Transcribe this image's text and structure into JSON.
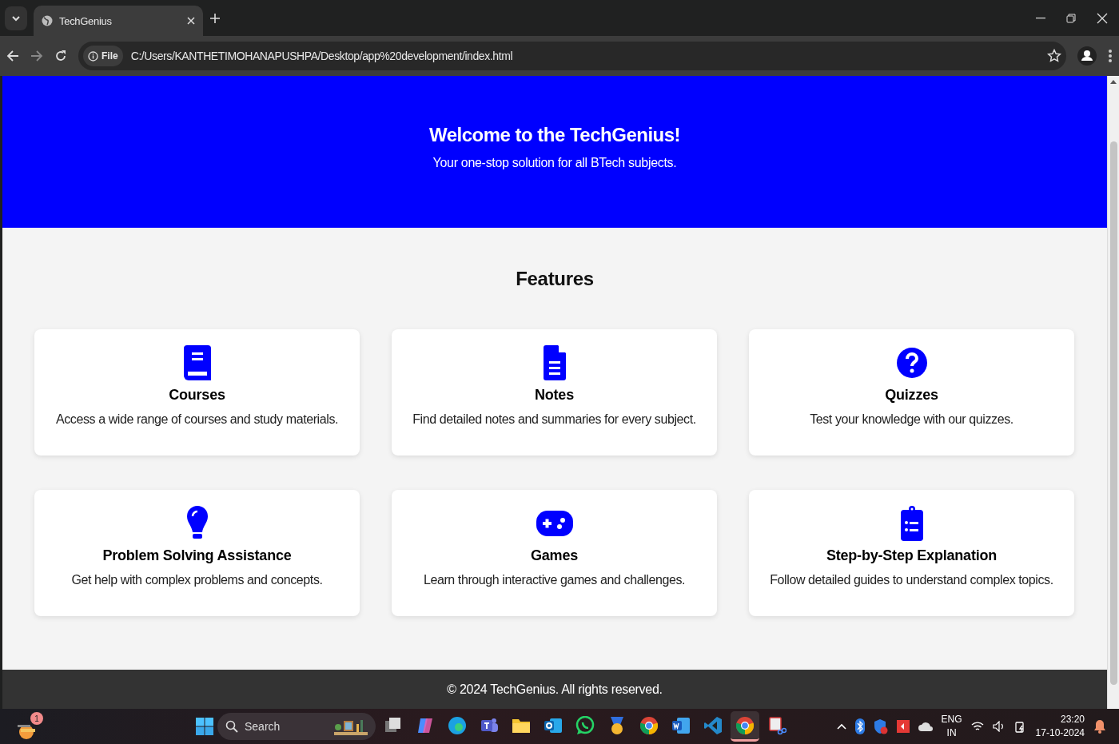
{
  "browser": {
    "tab": {
      "title": "TechGenius",
      "selected": true
    },
    "address": {
      "badge": "File",
      "url": "C:/Users/KANTHETIMOHANAPUSHPA/Desktop/app%20development/index.html"
    }
  },
  "hero": {
    "title": "Welcome to the TechGenius!",
    "subtitle": "Your one-stop solution for all BTech subjects."
  },
  "features": {
    "heading": "Features",
    "cards": [
      {
        "kind": "book",
        "title": "Courses",
        "text": "Access a wide range of courses and study materials."
      },
      {
        "kind": "file",
        "title": "Notes",
        "text": "Find detailed notes and summaries for every subject."
      },
      {
        "kind": "question",
        "title": "Quizzes",
        "text": "Test your knowledge with our quizzes."
      },
      {
        "kind": "bulb",
        "title": "Problem Solving Assistance",
        "text": "Get help with complex problems and concepts."
      },
      {
        "kind": "gamepad",
        "title": "Games",
        "text": "Learn through interactive games and challenges."
      },
      {
        "kind": "clipboard",
        "title": "Step-by-Step Explanation",
        "text": "Follow detailed guides to understand complex topics."
      }
    ]
  },
  "footer": {
    "text": "© 2024 TechGenius. All rights reserved."
  },
  "taskbar": {
    "widget_badge": "1",
    "search": {
      "placeholder": "Search"
    },
    "apps": [
      {
        "kind": "taskview",
        "selected": false
      },
      {
        "kind": "copilot",
        "selected": false
      },
      {
        "kind": "edge",
        "selected": false
      },
      {
        "kind": "teams",
        "selected": false
      },
      {
        "kind": "folder",
        "selected": false
      },
      {
        "kind": "outlook",
        "selected": false
      },
      {
        "kind": "whatsapp",
        "selected": false
      },
      {
        "kind": "medal",
        "selected": false
      },
      {
        "kind": "chrome",
        "selected": false
      },
      {
        "kind": "word",
        "selected": false
      },
      {
        "kind": "vscode",
        "selected": false
      },
      {
        "kind": "chrome",
        "selected": true
      },
      {
        "kind": "snip",
        "selected": false
      }
    ],
    "language": "ENG",
    "region": "IN",
    "time": "23:20",
    "date": "17-10-2024"
  }
}
